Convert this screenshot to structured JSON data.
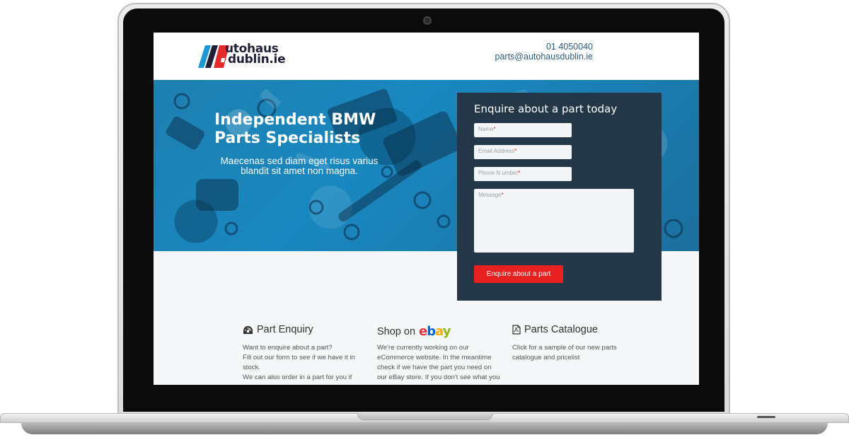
{
  "brand": {
    "line1": "utohaus",
    "line2": "dublin.ie",
    "colors": {
      "blue": "#1b9ad6",
      "dark": "#1f1f3a",
      "red": "#e32b2b"
    }
  },
  "contact": {
    "phone": "01 4050040",
    "email": "parts@autohausdublin.ie"
  },
  "hero": {
    "title": "Independent BMW Parts Specialists",
    "subtitle": "Maecenas sed diam eget risus varius blandit sit amet non magna."
  },
  "enquiry": {
    "title": "Enquire about a part today",
    "fields": [
      {
        "label": "Name",
        "required": "*"
      },
      {
        "label": "Email Address",
        "required": "*"
      },
      {
        "label": "Phone N umber",
        "required": "*"
      },
      {
        "label": "Message",
        "required": "*"
      }
    ],
    "button": "Enquire about a part",
    "button_color": "#e8201f",
    "panel_color": "#233748"
  },
  "features": [
    {
      "icon": "gauge-icon",
      "title": "Part Enquiry",
      "lines": [
        "Want to enquire about a part?",
        "Fill out our form to see if we have it in",
        "stock.",
        "We can also order in a part for you if"
      ]
    },
    {
      "title_prefix": "Shop on",
      "ebay": [
        "e",
        "b",
        "a",
        "y"
      ],
      "ebay_colors": [
        "#e53238",
        "#0064d2",
        "#f5af02",
        "#86b817"
      ],
      "lines": [
        "We're currently working on our",
        "eCommerce website. In the meantime",
        "check if we have the part you need on",
        "our eBay store. If you don't see what you"
      ]
    },
    {
      "icon": "pdf-file-icon",
      "title": "Parts Catalogue",
      "lines": [
        "Click for a sample of our new parts",
        "catalogue and pricelist"
      ]
    }
  ]
}
